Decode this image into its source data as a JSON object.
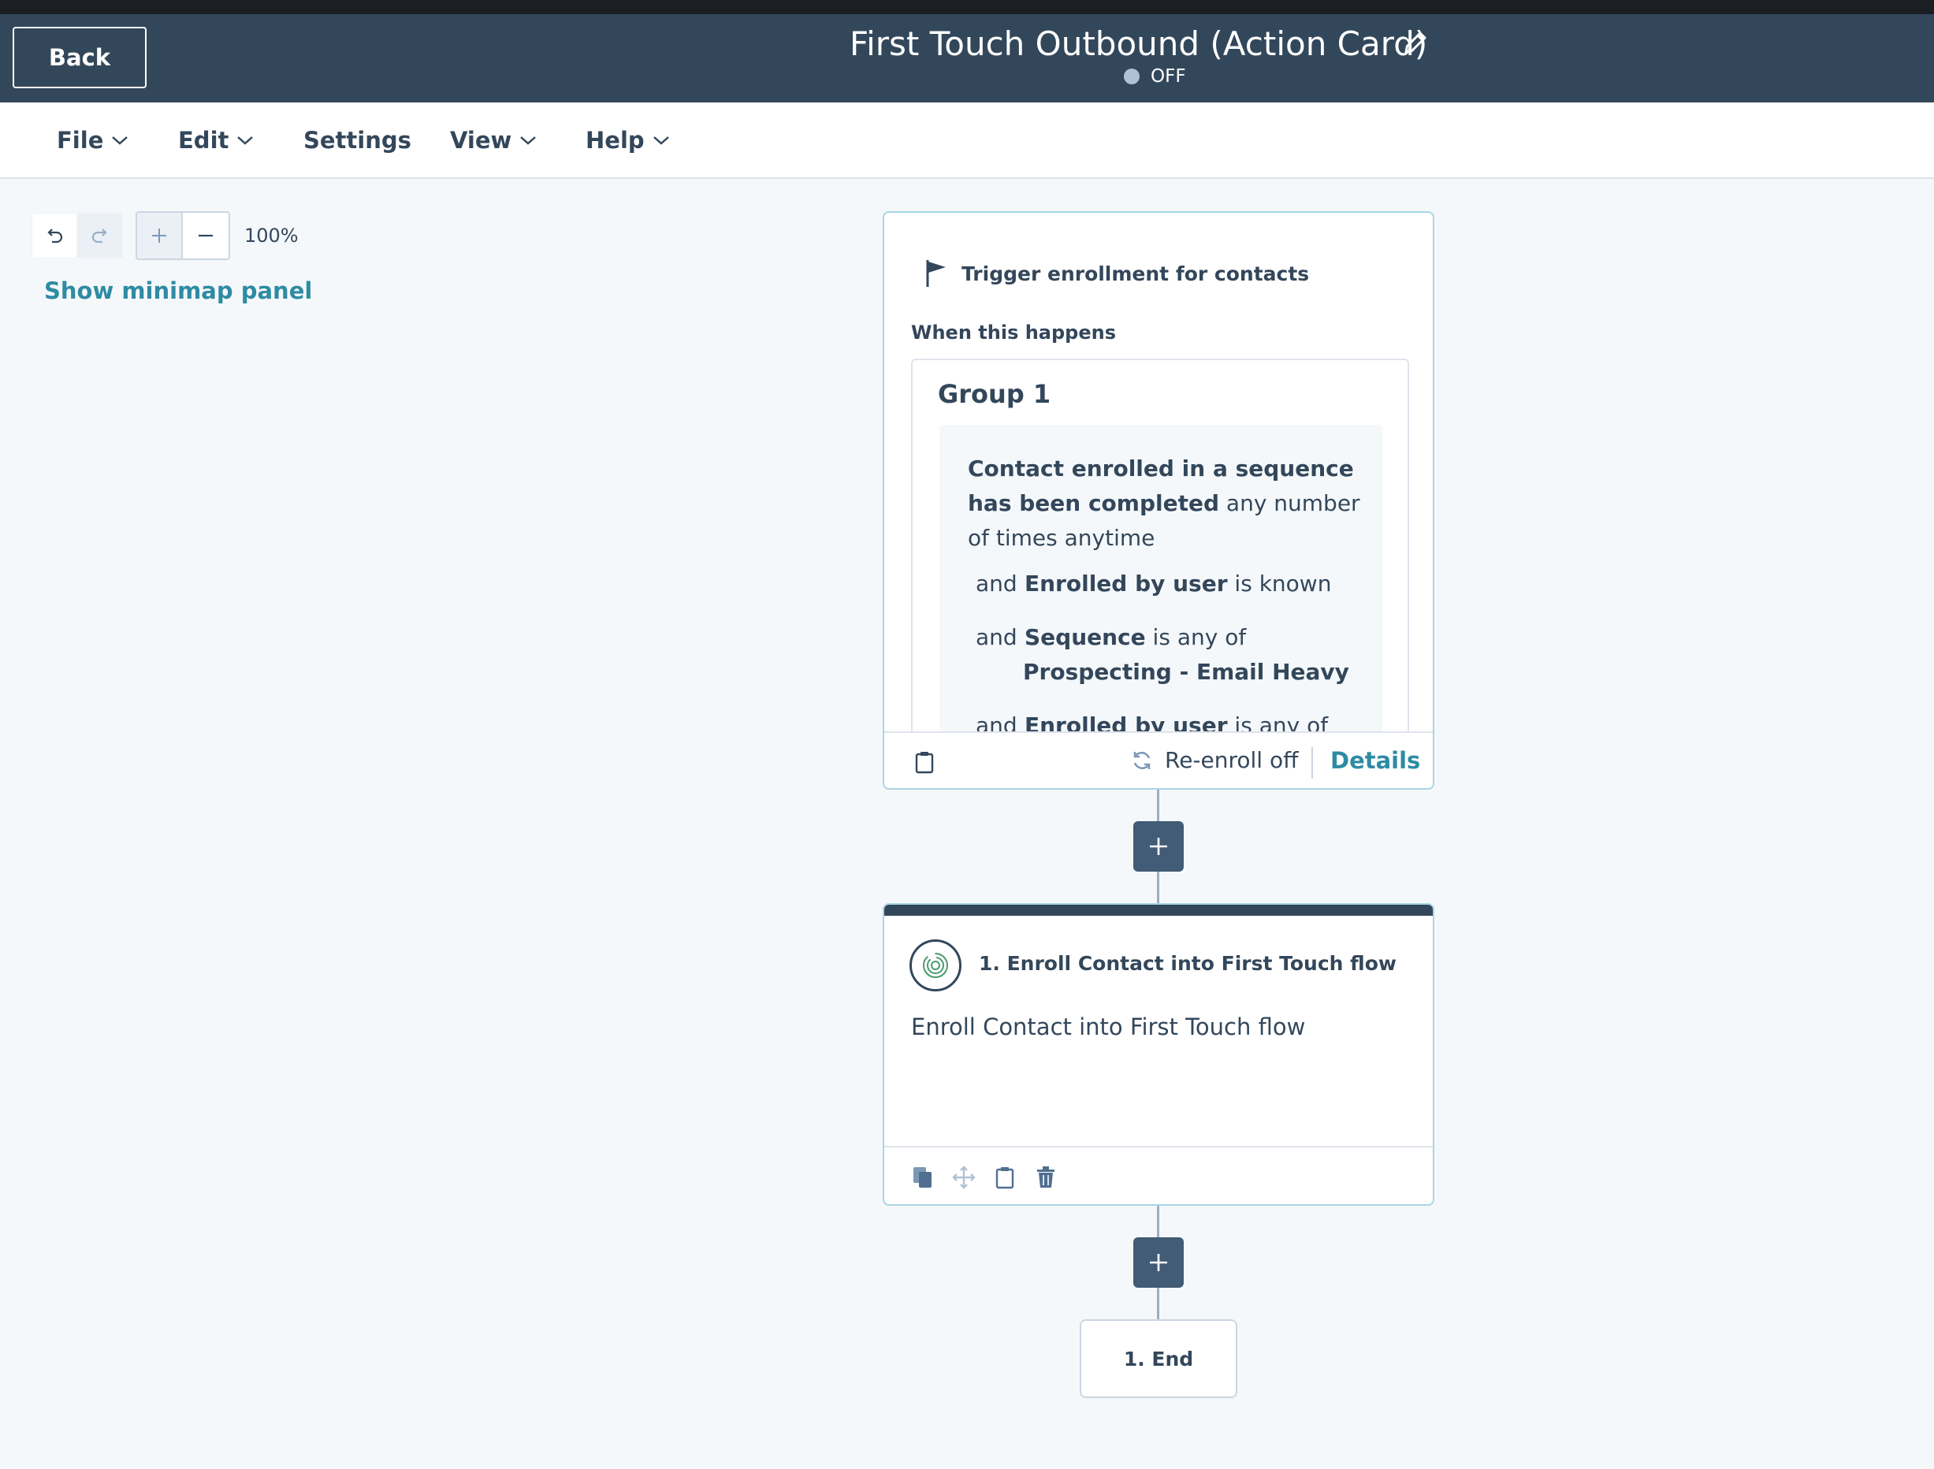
{
  "header": {
    "back_label": "Back",
    "title": "First Touch Outbound (Action Card)",
    "status": "OFF"
  },
  "menu": {
    "items": [
      {
        "label": "File",
        "has_dropdown": true
      },
      {
        "label": "Edit",
        "has_dropdown": true
      },
      {
        "label": "Settings",
        "has_dropdown": false
      },
      {
        "label": "View",
        "has_dropdown": true
      },
      {
        "label": "Help",
        "has_dropdown": true
      }
    ]
  },
  "toolbar": {
    "zoom_level": "100%",
    "minimap_link": "Show minimap panel"
  },
  "trigger": {
    "heading": "Trigger enrollment for contacts",
    "when_label": "When this happens",
    "group_title": "Group 1",
    "condition_bold": "Contact enrolled in a sequence has been completed",
    "condition_rest": " any number of times anytime",
    "filters": [
      {
        "and": "and",
        "field": "Enrolled by user",
        "op": " is known",
        "value": ""
      },
      {
        "and": "and",
        "field": "Sequence",
        "op": " is any of",
        "value": "Prospecting - Email Heavy"
      },
      {
        "and": "and",
        "field": "Enrolled by user",
        "op": " is any of",
        "value": ""
      }
    ],
    "reenroll": "Re-enroll off",
    "details_link": "Details"
  },
  "action": {
    "title": "1. Enroll Contact into First Touch flow",
    "description": "Enroll Contact into First Touch flow"
  },
  "end": {
    "label": "1. End"
  },
  "colors": {
    "header_bg": "#33475b",
    "canvas_bg": "#f5f8fa",
    "link": "#2e8ba3",
    "card_border": "#a8d5e6",
    "plus_button": "#425b76"
  }
}
